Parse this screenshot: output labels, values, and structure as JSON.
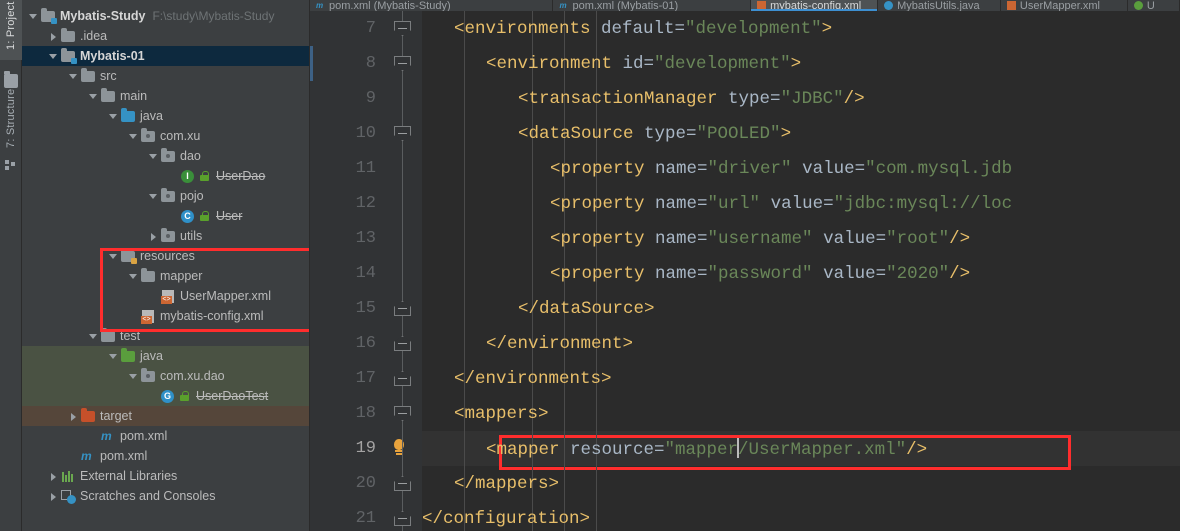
{
  "toolwindows": {
    "project": {
      "label": "1: Project",
      "icon": "folder-icon",
      "active": true
    },
    "structure": {
      "label": "7: Structure",
      "icon": "structure-icon",
      "active": false
    }
  },
  "project_tree": {
    "highlight_color": "#ff2d2d",
    "items": [
      {
        "label": "Mybatis-Study",
        "path": "F:\\study\\Mybatis-Study",
        "indent": 0,
        "arrow": "down",
        "icon": "module-folder-icon",
        "bold": true,
        "selected": false,
        "strike": false
      },
      {
        "label": ".idea",
        "path": "",
        "indent": 1,
        "arrow": "right",
        "icon": "folder-icon",
        "bold": false,
        "selected": false,
        "strike": false
      },
      {
        "label": "Mybatis-01",
        "path": "",
        "indent": 1,
        "arrow": "down",
        "icon": "module-folder-icon",
        "bold": true,
        "selected": true,
        "strike": false
      },
      {
        "label": "src",
        "path": "",
        "indent": 2,
        "arrow": "down",
        "icon": "folder-icon",
        "bold": false,
        "selected": false,
        "strike": false
      },
      {
        "label": "main",
        "path": "",
        "indent": 3,
        "arrow": "down",
        "icon": "folder-icon",
        "bold": false,
        "selected": false,
        "strike": false
      },
      {
        "label": "java",
        "path": "",
        "indent": 4,
        "arrow": "down",
        "icon": "source-folder-icon",
        "bold": false,
        "selected": false,
        "strike": false
      },
      {
        "label": "com.xu",
        "path": "",
        "indent": 5,
        "arrow": "down",
        "icon": "package-icon",
        "bold": false,
        "selected": false,
        "strike": false
      },
      {
        "label": "dao",
        "path": "",
        "indent": 6,
        "arrow": "down",
        "icon": "package-icon",
        "bold": false,
        "selected": false,
        "strike": false
      },
      {
        "label": "UserDao",
        "path": "",
        "indent": 7,
        "arrow": "none",
        "icon": "interface-icon",
        "bold": false,
        "selected": false,
        "strike": true
      },
      {
        "label": "pojo",
        "path": "",
        "indent": 6,
        "arrow": "down",
        "icon": "package-icon",
        "bold": false,
        "selected": false,
        "strike": false
      },
      {
        "label": "User",
        "path": "",
        "indent": 7,
        "arrow": "none",
        "icon": "class-icon",
        "bold": false,
        "selected": false,
        "strike": true
      },
      {
        "label": "utils",
        "path": "",
        "indent": 6,
        "arrow": "right",
        "icon": "package-icon",
        "bold": false,
        "selected": false,
        "strike": false
      },
      {
        "label": "resources",
        "path": "",
        "indent": 4,
        "arrow": "down",
        "icon": "resources-folder-icon",
        "bold": false,
        "selected": false,
        "strike": false
      },
      {
        "label": "mapper",
        "path": "",
        "indent": 5,
        "arrow": "down",
        "icon": "folder-icon",
        "bold": false,
        "selected": false,
        "strike": false
      },
      {
        "label": "UserMapper.xml",
        "path": "",
        "indent": 6,
        "arrow": "none",
        "icon": "xml-file-icon",
        "bold": false,
        "selected": false,
        "strike": false
      },
      {
        "label": "mybatis-config.xml",
        "path": "",
        "indent": 5,
        "arrow": "none",
        "icon": "xml-file-icon",
        "bold": false,
        "selected": false,
        "strike": false
      },
      {
        "label": "test",
        "path": "",
        "indent": 3,
        "arrow": "down",
        "icon": "folder-icon",
        "bold": false,
        "selected": false,
        "strike": false
      },
      {
        "label": "java",
        "path": "",
        "indent": 4,
        "arrow": "down",
        "icon": "test-source-folder-icon",
        "bold": false,
        "selected": false,
        "strike": false,
        "scope": "test"
      },
      {
        "label": "com.xu.dao",
        "path": "",
        "indent": 5,
        "arrow": "down",
        "icon": "package-icon",
        "bold": false,
        "selected": false,
        "strike": false,
        "scope": "test"
      },
      {
        "label": "UserDaoTest",
        "path": "",
        "indent": 6,
        "arrow": "none",
        "icon": "test-class-icon",
        "bold": false,
        "selected": false,
        "strike": true,
        "scope": "test"
      },
      {
        "label": "target",
        "path": "",
        "indent": 2,
        "arrow": "right",
        "icon": "excluded-folder-icon",
        "bold": false,
        "selected": false,
        "strike": false,
        "scope": "target"
      },
      {
        "label": "pom.xml",
        "path": "",
        "indent": 3,
        "arrow": "none",
        "icon": "maven-file-icon",
        "bold": false,
        "selected": false,
        "strike": false
      },
      {
        "label": "pom.xml",
        "path": "",
        "indent": 2,
        "arrow": "none",
        "icon": "maven-file-icon",
        "bold": false,
        "selected": false,
        "strike": false
      },
      {
        "label": "External Libraries",
        "path": "",
        "indent": 1,
        "arrow": "right",
        "icon": "libraries-icon",
        "bold": false,
        "selected": false,
        "strike": false
      },
      {
        "label": "Scratches and Consoles",
        "path": "",
        "indent": 1,
        "arrow": "right",
        "icon": "scratches-icon",
        "bold": false,
        "selected": false,
        "strike": false
      }
    ]
  },
  "editor": {
    "tabs": [
      {
        "label": "pom.xml (Mybatis-Study)",
        "icon": "maven-file-icon",
        "active": false
      },
      {
        "label": "pom.xml (Mybatis-01)",
        "icon": "maven-file-icon",
        "active": false
      },
      {
        "label": "mybatis-config.xml",
        "icon": "xml-file-icon",
        "active": true
      },
      {
        "label": "MybatisUtils.java",
        "icon": "java-class-icon",
        "active": false
      },
      {
        "label": "UserMapper.xml",
        "icon": "xml-file-icon",
        "active": false
      },
      {
        "label": "U",
        "icon": "green-class-icon",
        "active": false
      }
    ],
    "current_line": 19,
    "highlight_color": "#ff2d2d",
    "lines": [
      {
        "num": "7",
        "indent": 1,
        "fold": "down",
        "bulb": false,
        "parts": [
          {
            "t": "tag",
            "v": "<environments "
          },
          {
            "t": "attr",
            "v": "default="
          },
          {
            "t": "str",
            "v": "\"development\""
          },
          {
            "t": "tag",
            "v": ">"
          }
        ]
      },
      {
        "num": "8",
        "indent": 2,
        "fold": "down",
        "bulb": false,
        "changed": true,
        "parts": [
          {
            "t": "tag",
            "v": "<environment "
          },
          {
            "t": "attr",
            "v": "id="
          },
          {
            "t": "str",
            "v": "\"development\""
          },
          {
            "t": "tag",
            "v": ">"
          }
        ]
      },
      {
        "num": "9",
        "indent": 3,
        "fold": "none",
        "bulb": false,
        "parts": [
          {
            "t": "tag",
            "v": "<transactionManager "
          },
          {
            "t": "attr",
            "v": "type="
          },
          {
            "t": "str",
            "v": "\"JDBC\""
          },
          {
            "t": "tag",
            "v": "/>"
          }
        ]
      },
      {
        "num": "10",
        "indent": 3,
        "fold": "down",
        "bulb": false,
        "parts": [
          {
            "t": "tag",
            "v": "<dataSource "
          },
          {
            "t": "attr",
            "v": "type="
          },
          {
            "t": "str",
            "v": "\"POOLED\""
          },
          {
            "t": "tag",
            "v": ">"
          }
        ]
      },
      {
        "num": "11",
        "indent": 4,
        "fold": "none",
        "bulb": false,
        "parts": [
          {
            "t": "tag",
            "v": "<property "
          },
          {
            "t": "attr",
            "v": "name="
          },
          {
            "t": "str",
            "v": "\"driver\""
          },
          {
            "t": "attr",
            "v": " value="
          },
          {
            "t": "str",
            "v": "\"com.mysql.jdb"
          }
        ]
      },
      {
        "num": "12",
        "indent": 4,
        "fold": "none",
        "bulb": false,
        "parts": [
          {
            "t": "tag",
            "v": "<property "
          },
          {
            "t": "attr",
            "v": "name="
          },
          {
            "t": "str",
            "v": "\"url\""
          },
          {
            "t": "attr",
            "v": " value="
          },
          {
            "t": "str",
            "v": "\"jdbc:mysql://loc"
          }
        ]
      },
      {
        "num": "13",
        "indent": 4,
        "fold": "none",
        "bulb": false,
        "parts": [
          {
            "t": "tag",
            "v": "<property "
          },
          {
            "t": "attr",
            "v": "name="
          },
          {
            "t": "str",
            "v": "\"username\""
          },
          {
            "t": "attr",
            "v": " value="
          },
          {
            "t": "str",
            "v": "\"root\""
          },
          {
            "t": "tag",
            "v": "/>"
          }
        ]
      },
      {
        "num": "14",
        "indent": 4,
        "fold": "none",
        "bulb": false,
        "parts": [
          {
            "t": "tag",
            "v": "<property "
          },
          {
            "t": "attr",
            "v": "name="
          },
          {
            "t": "str",
            "v": "\"password\""
          },
          {
            "t": "attr",
            "v": " value="
          },
          {
            "t": "str",
            "v": "\"2020\""
          },
          {
            "t": "tag",
            "v": "/>"
          }
        ]
      },
      {
        "num": "15",
        "indent": 3,
        "fold": "up",
        "bulb": false,
        "parts": [
          {
            "t": "tag",
            "v": "</dataSource>"
          }
        ]
      },
      {
        "num": "16",
        "indent": 2,
        "fold": "up",
        "bulb": false,
        "parts": [
          {
            "t": "tag",
            "v": "</environment>"
          }
        ]
      },
      {
        "num": "17",
        "indent": 1,
        "fold": "up",
        "bulb": false,
        "parts": [
          {
            "t": "tag",
            "v": "</environments>"
          }
        ]
      },
      {
        "num": "18",
        "indent": 1,
        "fold": "down",
        "bulb": false,
        "parts": [
          {
            "t": "tag",
            "v": "<mappers>"
          }
        ]
      },
      {
        "num": "19",
        "indent": 2,
        "fold": "none",
        "bulb": true,
        "current": true,
        "caret_after": 2,
        "parts": [
          {
            "t": "tag",
            "v": "<mapper "
          },
          {
            "t": "attr",
            "v": "resource="
          },
          {
            "t": "str",
            "v": "\"mapper"
          },
          {
            "t": "caret",
            "v": ""
          },
          {
            "t": "str",
            "v": "/UserMapper.xml\""
          },
          {
            "t": "tag",
            "v": "/>"
          }
        ]
      },
      {
        "num": "20",
        "indent": 1,
        "fold": "up",
        "bulb": false,
        "parts": [
          {
            "t": "tag",
            "v": "</mappers>"
          }
        ]
      },
      {
        "num": "21",
        "indent": 0,
        "fold": "up",
        "bulb": false,
        "parts": [
          {
            "t": "tag",
            "v": "</configuration>"
          }
        ]
      }
    ]
  }
}
